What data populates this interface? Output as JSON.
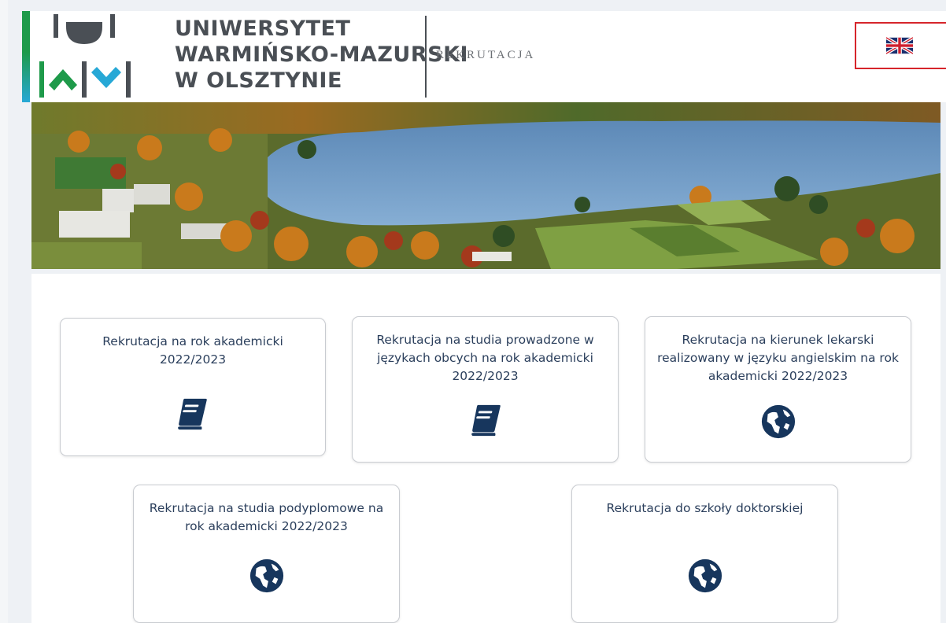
{
  "header": {
    "university_name_lines": [
      "UNIWERSYTET",
      "WARMIŃSKO-MAZURSKI",
      "W OLSZTYNIE"
    ],
    "section_title": "REKRUTACJA",
    "language_switch": {
      "icon": "uk-flag-icon",
      "alt": "English"
    },
    "colors": {
      "green": "#1e9a4a",
      "blue": "#27a8d6",
      "text": "#4a4f55",
      "highlight": "#d6252b"
    }
  },
  "banner": {
    "description_icon": "campus-lake-photo"
  },
  "cards": [
    {
      "title": "Rekrutacja na rok akademicki 2022/2023",
      "icon": "book-icon"
    },
    {
      "title": "Rekrutacja na studia prowadzone w językach obcych na rok akademicki 2022/2023",
      "icon": "book-icon"
    },
    {
      "title": "Rekrutacja na kierunek lekarski realizowany w języku angielskim na rok akademicki 2022/2023",
      "icon": "globe-icon"
    },
    {
      "title": "Rekrutacja na studia podyplomowe na rok akademicki 2022/2023",
      "icon": "globe-icon"
    },
    {
      "title": "Rekrutacja do szkoły doktorskiej",
      "icon": "globe-icon"
    }
  ],
  "theme": {
    "icon_color": "#17365d",
    "card_text_color": "#2b3f5c"
  }
}
